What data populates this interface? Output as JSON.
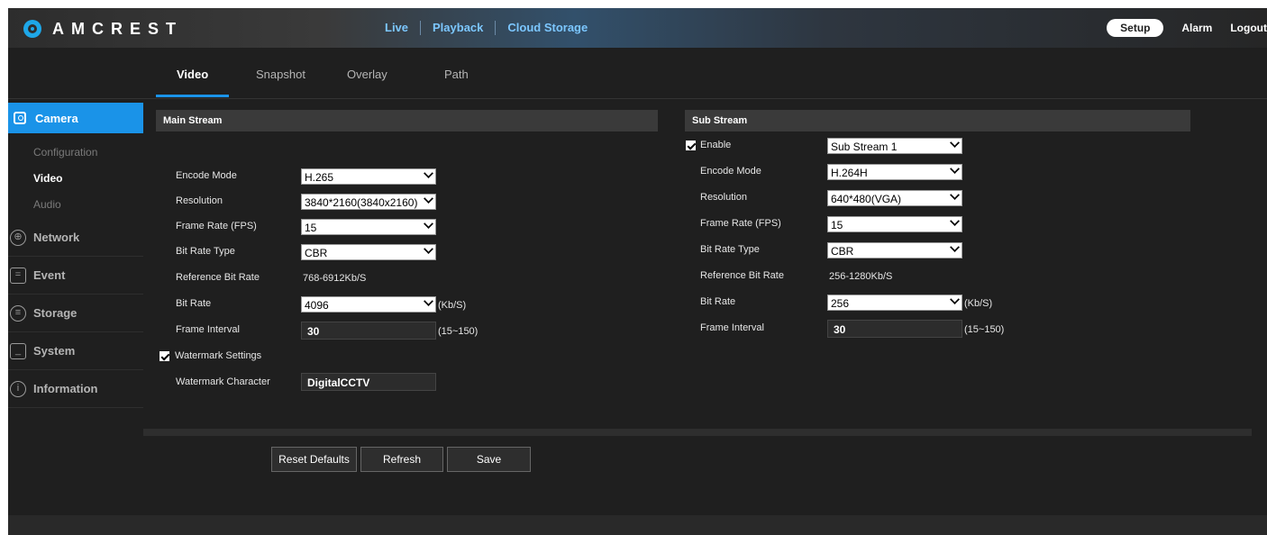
{
  "header": {
    "logo_text": "AMCREST",
    "nav": [
      "Live",
      "Playback",
      "Cloud Storage"
    ],
    "setup": "Setup",
    "alarm": "Alarm",
    "logout": "Logout"
  },
  "sidebar": {
    "active": "Camera",
    "sub_items": [
      "Configuration",
      "Video",
      "Audio"
    ],
    "items": [
      "Network",
      "Event",
      "Storage",
      "System",
      "Information"
    ]
  },
  "tabs": [
    "Video",
    "Snapshot",
    "Overlay",
    "Path"
  ],
  "main": {
    "title": "Main Stream",
    "fields": {
      "encode_mode": {
        "label": "Encode Mode",
        "value": "H.265"
      },
      "resolution": {
        "label": "Resolution",
        "value": "3840*2160(3840x2160)"
      },
      "frame_rate": {
        "label": "Frame Rate (FPS)",
        "value": "15"
      },
      "bit_rate_type": {
        "label": "Bit Rate Type",
        "value": "CBR"
      },
      "ref_bit_rate": {
        "label": "Reference Bit Rate",
        "value": "768-6912Kb/S"
      },
      "bit_rate": {
        "label": "Bit Rate",
        "value": "4096",
        "unit": "(Kb/S)"
      },
      "frame_interval": {
        "label": "Frame Interval",
        "value": "30",
        "range": "(15~150)"
      }
    },
    "watermark": {
      "label": "Watermark Settings",
      "char_label": "Watermark Character",
      "char_value": "DigitalCCTV"
    }
  },
  "sub": {
    "title": "Sub Stream",
    "enable_label": "Enable",
    "stream_value": "Sub Stream 1",
    "fields": {
      "encode_mode": {
        "label": "Encode Mode",
        "value": "H.264H"
      },
      "resolution": {
        "label": "Resolution",
        "value": "640*480(VGA)"
      },
      "frame_rate": {
        "label": "Frame Rate (FPS)",
        "value": "15"
      },
      "bit_rate_type": {
        "label": "Bit Rate Type",
        "value": "CBR"
      },
      "ref_bit_rate": {
        "label": "Reference Bit Rate",
        "value": "256-1280Kb/S"
      },
      "bit_rate": {
        "label": "Bit Rate",
        "value": "256",
        "unit": "(Kb/S)"
      },
      "frame_interval": {
        "label": "Frame Interval",
        "value": "30",
        "range": "(15~150)"
      }
    }
  },
  "buttons": {
    "reset": "Reset Defaults",
    "refresh": "Refresh",
    "save": "Save"
  },
  "colors": {
    "accent": "#1a93e8",
    "nav_link": "#7cc7ff",
    "background": "#1f1f1f"
  }
}
